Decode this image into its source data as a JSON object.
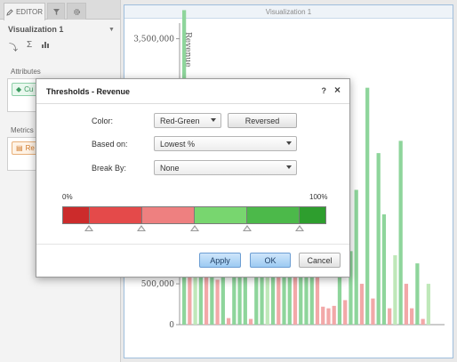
{
  "editor": {
    "tab_label": "EDITOR",
    "viz_name": "Visualization 1",
    "attributes_label": "Attributes",
    "attribute_chip": "Cu",
    "metrics_label": "Metrics",
    "metric_chip": "Re"
  },
  "visualization": {
    "title": "Visualization 1",
    "chart_data": {
      "type": "bar",
      "ylabel": "Revenue",
      "yticks": [
        "3,500,000",
        "500,000",
        "0"
      ],
      "ylim": [
        0,
        3800000
      ],
      "colors": {
        "green": "#8ed59b",
        "light_green": "#bfe8b9",
        "red": "#f2a8a8"
      },
      "series": [
        {
          "values": [
            3850000,
            2300000,
            600000,
            1200000,
            700000,
            2200000,
            550000,
            600000,
            80000,
            2300000,
            1950000,
            2400000,
            70000,
            1300000,
            1200000,
            800000,
            2500000,
            600000,
            2800000,
            2300000,
            600000,
            2200000,
            1750000,
            950000,
            600000,
            220000,
            200000,
            230000,
            580000,
            300000,
            900000,
            1650000,
            500000,
            2900000,
            320000,
            2100000,
            1350000,
            200000,
            850000,
            2250000,
            500000,
            200000,
            750000,
            70000,
            500000
          ],
          "colors": [
            "g",
            "r",
            "lg",
            "g",
            "r",
            "g",
            "r",
            "g",
            "r",
            "g",
            "g",
            "g",
            "r",
            "g",
            "g",
            "lg",
            "g",
            "r",
            "g",
            "g",
            "r",
            "g",
            "g",
            "g",
            "r",
            "r",
            "r",
            "r",
            "g",
            "r",
            "g",
            "g",
            "r",
            "g",
            "r",
            "g",
            "g",
            "r",
            "lg",
            "g",
            "r",
            "r",
            "g",
            "r",
            "lg"
          ]
        }
      ]
    }
  },
  "dialog": {
    "title": "Thresholds - Revenue",
    "help": "?",
    "close": "×",
    "color_label": "Color:",
    "color_value": "Red-Green",
    "reversed_button": "Reversed",
    "based_on_label": "Based on:",
    "based_on_value": "Lowest %",
    "break_by_label": "Break By:",
    "break_by_value": "None",
    "min_label": "0%",
    "max_label": "100%",
    "band_colors": [
      "#cc2b2b",
      "#e44a4a",
      "#ee8080",
      "#78d66f",
      "#4cb94a",
      "#2e9e2e"
    ],
    "thresholds_percent": [
      0,
      10,
      30,
      50,
      70,
      90,
      100
    ],
    "apply_button": "Apply",
    "ok_button": "OK",
    "cancel_button": "Cancel"
  }
}
